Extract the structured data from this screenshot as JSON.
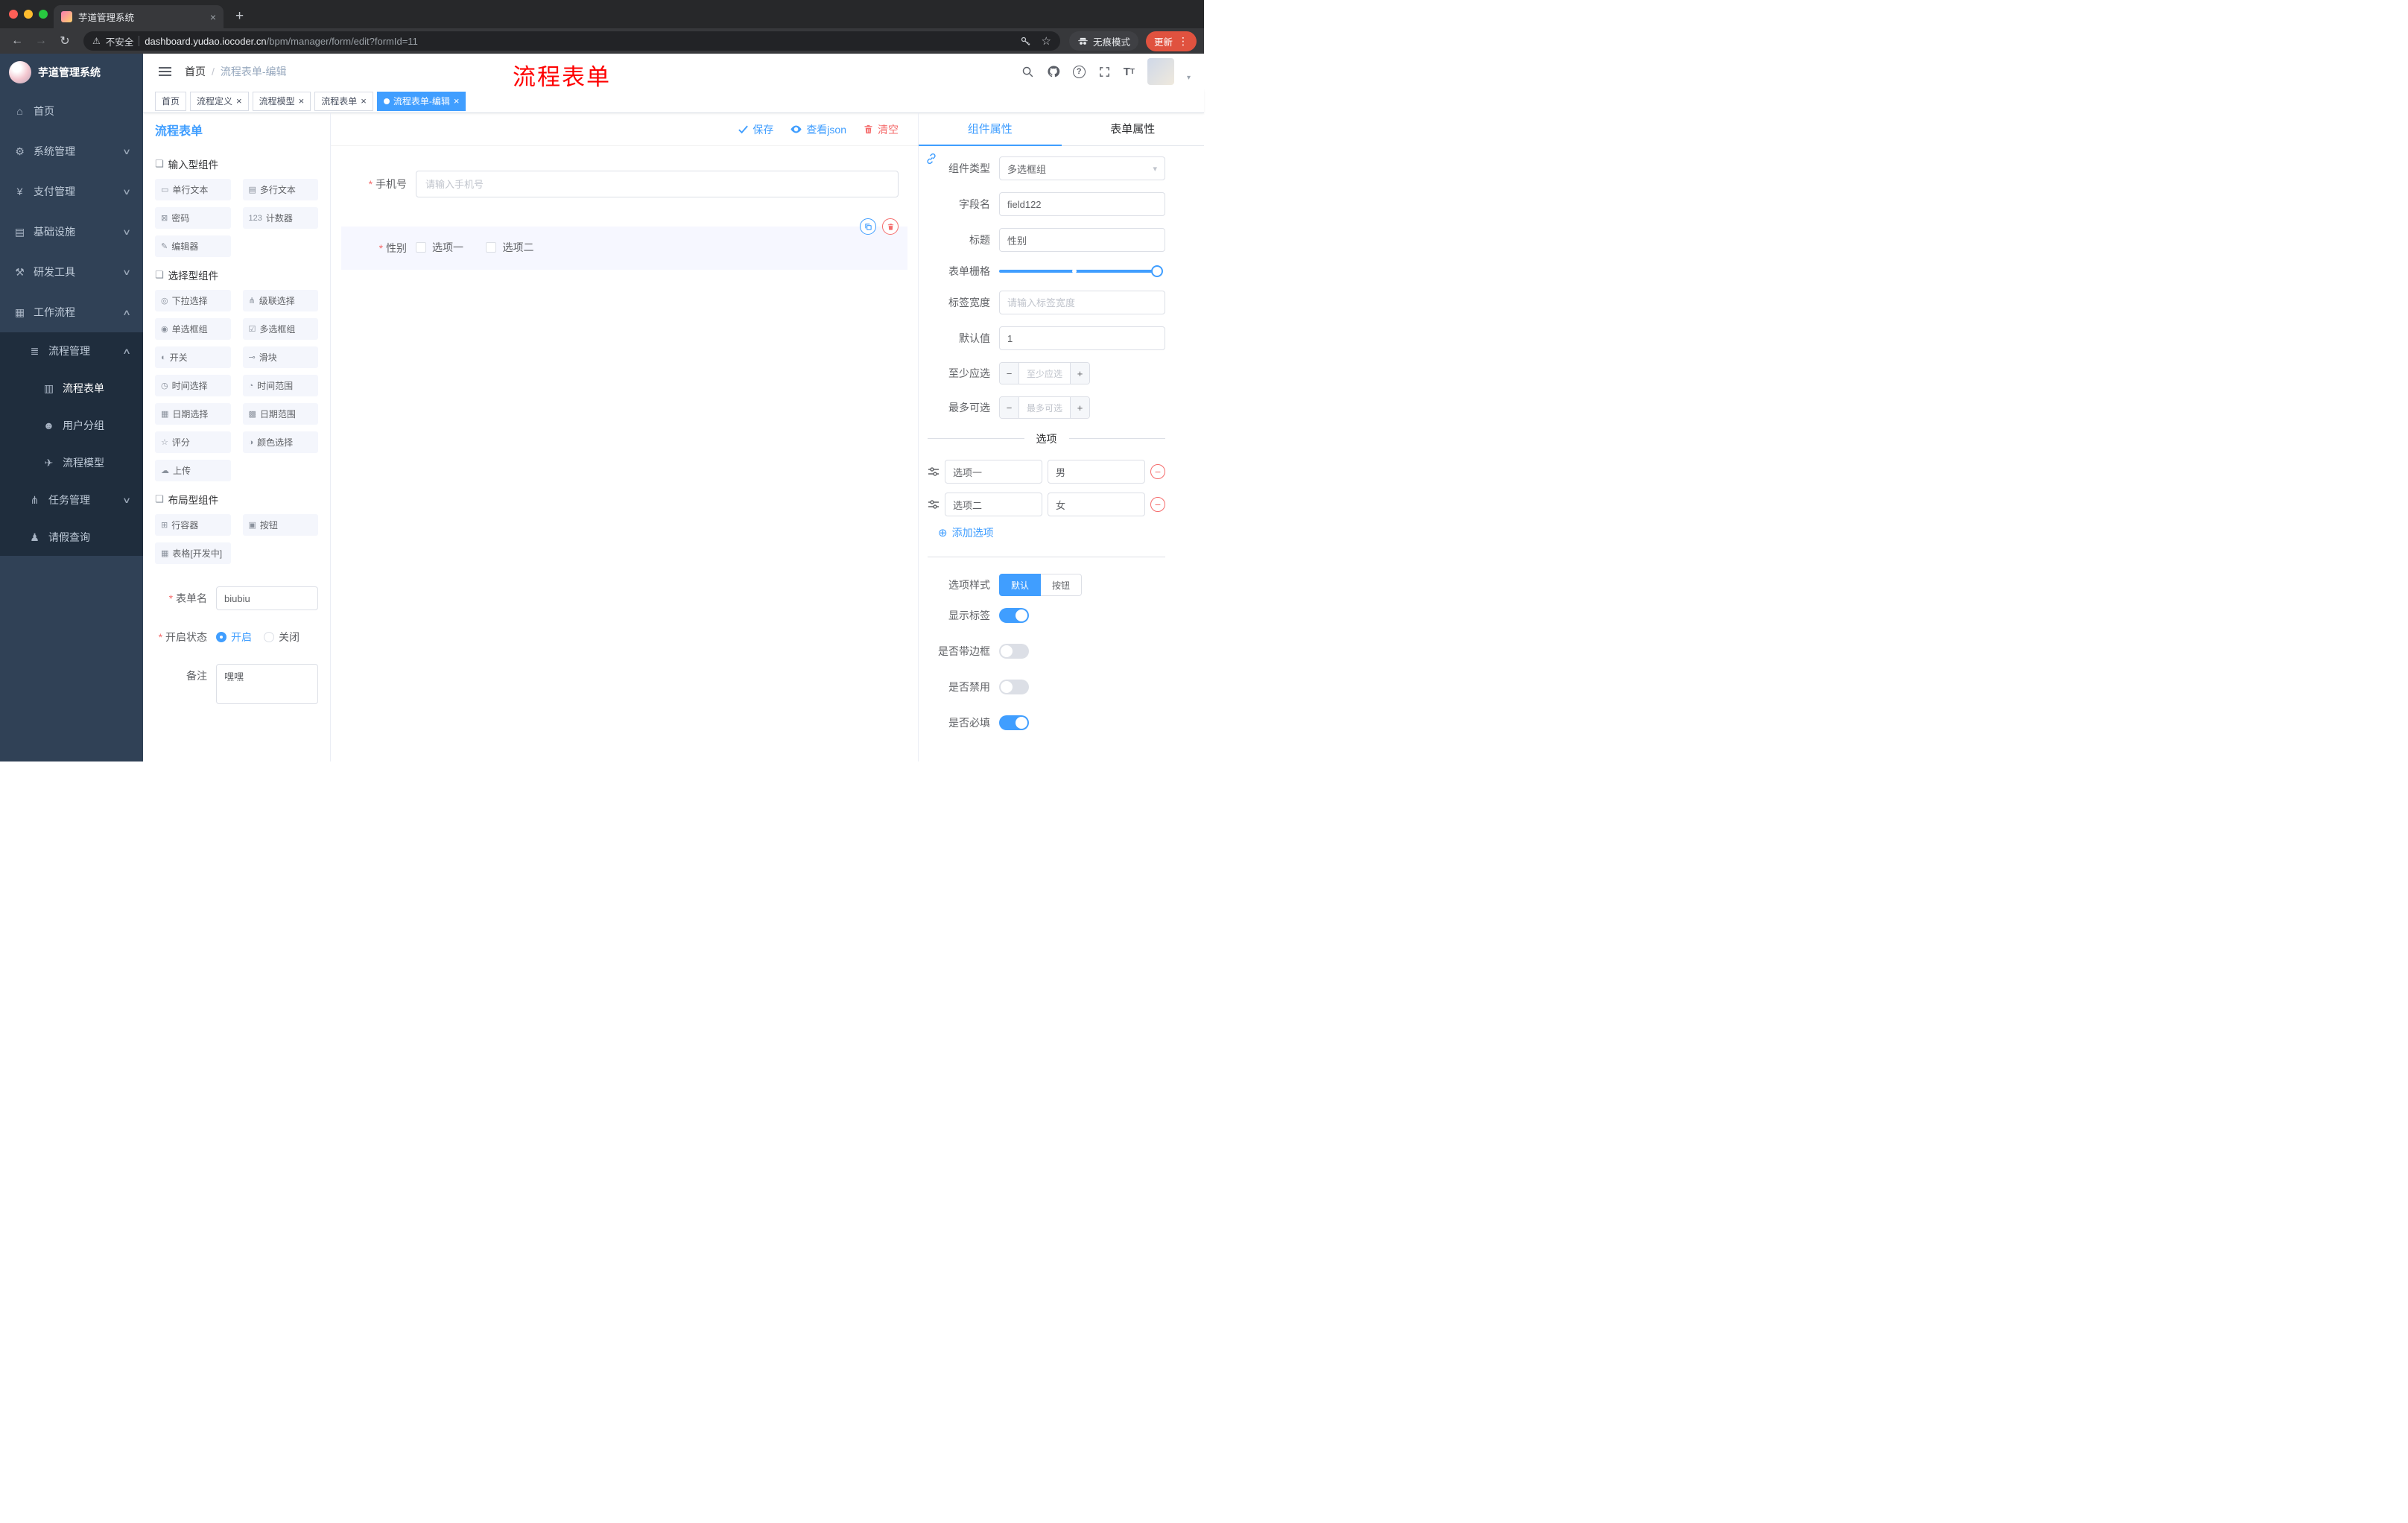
{
  "browser": {
    "tab_title": "芋道管理系统",
    "security_label": "不安全",
    "url_domain": "dashboard.yudao.iocoder.cn",
    "url_path": "/bpm/manager/form/edit?formId=11",
    "incognito_label": "无痕模式",
    "update_label": "更新"
  },
  "sidebar": {
    "logo_title": "芋道管理系统",
    "items": [
      {
        "label": "首页",
        "icon": "⌂"
      },
      {
        "label": "系统管理",
        "icon": "⚙"
      },
      {
        "label": "支付管理",
        "icon": "¥"
      },
      {
        "label": "基础设施",
        "icon": "▤"
      },
      {
        "label": "研发工具",
        "icon": "⚒"
      },
      {
        "label": "工作流程",
        "icon": "▦"
      },
      {
        "label": "流程管理",
        "icon": "≣"
      },
      {
        "label": "流程表单",
        "icon": "▥"
      },
      {
        "label": "用户分组",
        "icon": "☻"
      },
      {
        "label": "流程模型",
        "icon": "✈"
      },
      {
        "label": "任务管理",
        "icon": "⋔"
      },
      {
        "label": "请假查询",
        "icon": "♟"
      }
    ]
  },
  "header": {
    "breadcrumb_home": "首页",
    "breadcrumb_current": "流程表单-编辑",
    "annotation": "流程表单"
  },
  "tags": {
    "items": [
      {
        "label": "首页",
        "closable": false,
        "active": false
      },
      {
        "label": "流程定义",
        "closable": true,
        "active": false
      },
      {
        "label": "流程模型",
        "closable": true,
        "active": false
      },
      {
        "label": "流程表单",
        "closable": true,
        "active": false
      },
      {
        "label": "流程表单-编辑",
        "closable": true,
        "active": true
      }
    ]
  },
  "designer": {
    "panel_title": "流程表单",
    "save_label": "保存",
    "view_json_label": "查看json",
    "clear_label": "清空",
    "palette": [
      {
        "title": "输入型组件",
        "items": [
          {
            "label": "单行文本",
            "icon": "▭",
            "icon_name": "single-line-text-icon"
          },
          {
            "label": "多行文本",
            "icon": "▤",
            "icon_name": "textarea-icon"
          },
          {
            "label": "密码",
            "icon": "⊠",
            "icon_name": "password-icon"
          },
          {
            "label": "计数器",
            "icon": "123",
            "icon_name": "counter-icon"
          },
          {
            "label": "编辑器",
            "icon": "✎",
            "icon_name": "rich-editor-icon"
          }
        ]
      },
      {
        "title": "选择型组件",
        "items": [
          {
            "label": "下拉选择",
            "icon": "◎",
            "icon_name": "select-icon"
          },
          {
            "label": "级联选择",
            "icon": "⋔",
            "icon_name": "cascader-icon"
          },
          {
            "label": "单选框组",
            "icon": "◉",
            "icon_name": "radio-group-icon"
          },
          {
            "label": "多选框组",
            "icon": "☑",
            "icon_name": "checkbox-group-icon"
          },
          {
            "label": "开关",
            "icon": "◐",
            "icon_name": "switch-icon"
          },
          {
            "label": "滑块",
            "icon": "⊸",
            "icon_name": "slider-icon"
          },
          {
            "label": "时间选择",
            "icon": "◷",
            "icon_name": "time-picker-icon"
          },
          {
            "label": "时间范围",
            "icon": "◔",
            "icon_name": "time-range-icon"
          },
          {
            "label": "日期选择",
            "icon": "▦",
            "icon_name": "date-picker-icon"
          },
          {
            "label": "日期范围",
            "icon": "▩",
            "icon_name": "date-range-icon"
          },
          {
            "label": "评分",
            "icon": "☆",
            "icon_name": "rate-icon"
          },
          {
            "label": "颜色选择",
            "icon": "◑",
            "icon_name": "color-picker-icon"
          },
          {
            "label": "上传",
            "icon": "☁",
            "icon_name": "upload-icon"
          }
        ]
      },
      {
        "title": "布局型组件",
        "items": [
          {
            "label": "行容器",
            "icon": "⊞",
            "icon_name": "row-container-icon"
          },
          {
            "label": "按钮",
            "icon": "▣",
            "icon_name": "button-icon"
          },
          {
            "label": "表格[开发中]",
            "icon": "▦",
            "icon_name": "table-icon"
          }
        ]
      }
    ],
    "meta": {
      "form_name_label": "表单名",
      "form_name_value": "biubiu",
      "status_label": "开启状态",
      "status_on": "开启",
      "status_off": "关闭",
      "remark_label": "备注",
      "remark_value": "嘿嘿"
    },
    "canvas": {
      "phone_label": "手机号",
      "phone_placeholder": "请输入手机号",
      "gender_label": "性别",
      "gender_options": [
        {
          "label": "选项一"
        },
        {
          "label": "选项二"
        }
      ]
    }
  },
  "props": {
    "tab_component": "组件属性",
    "tab_form": "表单属性",
    "component_type_label": "组件类型",
    "component_type_value": "多选框组",
    "field_name_label": "字段名",
    "field_name_value": "field122",
    "title_label": "标题",
    "title_value": "性别",
    "grid_label": "表单栅格",
    "label_width_label": "标签宽度",
    "label_width_placeholder": "请输入标签宽度",
    "default_label": "默认值",
    "default_value": "1",
    "min_label": "至少应选",
    "min_placeholder": "至少应选",
    "max_label": "最多可选",
    "max_placeholder": "最多可选",
    "options_title": "选项",
    "options": [
      {
        "label": "选项一",
        "value": "男"
      },
      {
        "label": "选项二",
        "value": "女"
      }
    ],
    "add_option_label": "添加选项",
    "option_style_label": "选项样式",
    "option_style_default": "默认",
    "option_style_button": "按钮",
    "switches": [
      {
        "label": "显示标签",
        "state": "on"
      },
      {
        "label": "是否带边框",
        "state": "off"
      },
      {
        "label": "是否禁用",
        "state": "off"
      },
      {
        "label": "是否必填",
        "state": "on"
      }
    ],
    "accent_color": "#409eff",
    "danger_color": "#f56c6c"
  }
}
